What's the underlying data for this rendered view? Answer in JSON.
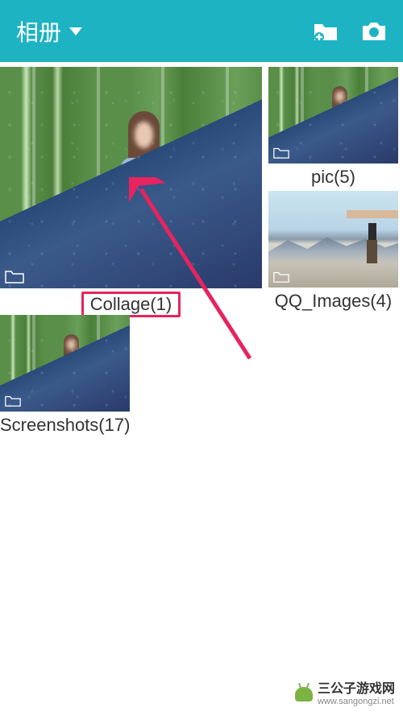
{
  "header": {
    "title": "相册",
    "icons": {
      "dropdown": "chevron-down",
      "new_folder": "new-folder",
      "camera": "camera"
    }
  },
  "albums": [
    {
      "name": "Collage",
      "count": 1,
      "label": "Collage(1)",
      "highlighted": true,
      "thumb_style": "bamboo-diag"
    },
    {
      "name": "pic",
      "count": 5,
      "label": "pic(5)",
      "highlighted": false,
      "thumb_style": "bamboo-diag"
    },
    {
      "name": "QQ_Images",
      "count": 4,
      "label": "QQ_Images(4)",
      "highlighted": false,
      "thumb_style": "mountain"
    },
    {
      "name": "Screenshots",
      "count": 17,
      "label": "Screenshots(17)",
      "highlighted": false,
      "thumb_style": "bamboo-diag"
    }
  ],
  "annotation": {
    "arrow_color": "#e6245f"
  },
  "watermark": {
    "text": "三公子游戏网",
    "url": "www.sangongzi.net"
  },
  "colors": {
    "accent": "#1eb3c3",
    "highlight": "#e6245f"
  }
}
